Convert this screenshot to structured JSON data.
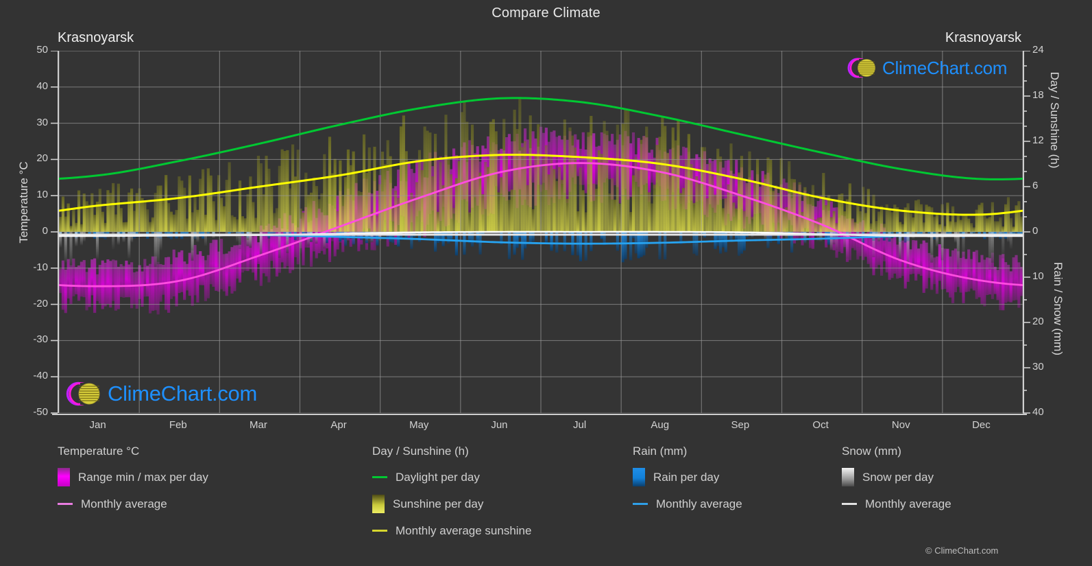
{
  "title": "Compare Climate",
  "city_left": "Krasnoyarsk",
  "city_right": "Krasnoyarsk",
  "axes": {
    "y_left_title": "Temperature °C",
    "y_right_day_title": "Day / Sunshine (h)",
    "y_right_rain_title": "Rain / Snow (mm)",
    "y_left_ticks": [
      "50",
      "40",
      "30",
      "20",
      "10",
      "0",
      "-10",
      "-20",
      "-30",
      "-40",
      "-50"
    ],
    "y_right_day_ticks": [
      "24",
      "18",
      "12",
      "6",
      "0"
    ],
    "y_right_rain_ticks": [
      "0",
      "10",
      "20",
      "30",
      "40"
    ],
    "x_ticks": [
      "Jan",
      "Feb",
      "Mar",
      "Apr",
      "May",
      "Jun",
      "Jul",
      "Aug",
      "Sep",
      "Oct",
      "Nov",
      "Dec"
    ]
  },
  "legend": {
    "temperature": {
      "heading": "Temperature °C",
      "range_label": "Range min / max per day",
      "average_label": "Monthly average"
    },
    "day_sunshine": {
      "heading": "Day / Sunshine (h)",
      "daylight_label": "Daylight per day",
      "sunshine_label": "Sunshine per day",
      "average_label": "Monthly average sunshine"
    },
    "rain": {
      "heading": "Rain (mm)",
      "rain_label": "Rain per day",
      "average_label": "Monthly average"
    },
    "snow": {
      "heading": "Snow (mm)",
      "snow_label": "Snow per day",
      "average_label": "Monthly average"
    }
  },
  "copyright": "© ClimeChart.com",
  "watermark_text": "ClimeChart.com",
  "colors": {
    "background": "#333333",
    "plot_background": "#343434",
    "grid": "#8d8d8d",
    "axis": "#cfcfcf",
    "temp_range": "#d400d4",
    "temp_avg": "#ff4de0",
    "daylight": "#00c832",
    "sunshine_band": "#c8c832",
    "sunshine_avg": "#ffff00",
    "rain_bar": "#0a7ad8",
    "rain_avg": "#27a3f0",
    "snow_bar": "#e8e8e8",
    "snow_avg": "#ffffff",
    "watermark_text": "#1e90ff"
  },
  "chart_data": {
    "type": "area",
    "title": "Compare Climate",
    "subtitle": "Krasnoyarsk",
    "xlabel": "",
    "ylabel": "Temperature °C",
    "ylim": [
      -50,
      50
    ],
    "y_right_day_lim": [
      0,
      24
    ],
    "y_right_rain_lim": [
      0,
      40
    ],
    "grid": true,
    "legend_position": "below",
    "categories": [
      "Jan",
      "Feb",
      "Mar",
      "Apr",
      "May",
      "Jun",
      "Jul",
      "Aug",
      "Sep",
      "Oct",
      "Nov",
      "Dec"
    ],
    "series": [
      {
        "name": "Monthly average temperature",
        "unit": "°C",
        "color": "#ff4de0",
        "values": [
          -15.0,
          -13.5,
          -6.5,
          1.5,
          9.5,
          16.5,
          19.0,
          16.5,
          10.0,
          2.0,
          -8.0,
          -13.5
        ]
      },
      {
        "name": "Daily max temperature (range top)",
        "unit": "°C",
        "color": "#d400d4",
        "values": [
          -10.0,
          -8.0,
          -1.0,
          8.0,
          17.0,
          23.0,
          25.0,
          22.0,
          16.0,
          7.0,
          -3.0,
          -8.5
        ]
      },
      {
        "name": "Daily min temperature (range bottom)",
        "unit": "°C",
        "color": "#d400d4",
        "values": [
          -19.0,
          -18.0,
          -11.0,
          -3.0,
          3.0,
          10.0,
          13.0,
          11.0,
          5.0,
          -2.0,
          -12.0,
          -17.5
        ]
      },
      {
        "name": "Daylight per day",
        "unit": "h",
        "color": "#00c832",
        "values": [
          7.5,
          9.4,
          11.7,
          14.2,
          16.4,
          17.7,
          17.2,
          15.3,
          12.9,
          10.5,
          8.3,
          7.0
        ]
      },
      {
        "name": "Monthly average sunshine",
        "unit": "h",
        "color": "#ffff00",
        "values": [
          3.5,
          4.5,
          6.0,
          7.5,
          9.4,
          10.2,
          9.9,
          9.0,
          7.0,
          4.5,
          2.8,
          2.3
        ]
      },
      {
        "name": "Monthly average rain",
        "unit": "mm",
        "color": "#27a3f0",
        "values": [
          0.6,
          0.6,
          0.7,
          1.1,
          1.6,
          2.3,
          2.6,
          2.4,
          1.9,
          1.5,
          0.9,
          0.6
        ]
      },
      {
        "name": "Monthly average snow",
        "unit": "mm",
        "color": "#ffffff",
        "values": [
          0.9,
          0.8,
          0.7,
          0.4,
          0.1,
          0.0,
          0.0,
          0.0,
          0.1,
          0.5,
          0.9,
          0.9
        ]
      }
    ]
  }
}
